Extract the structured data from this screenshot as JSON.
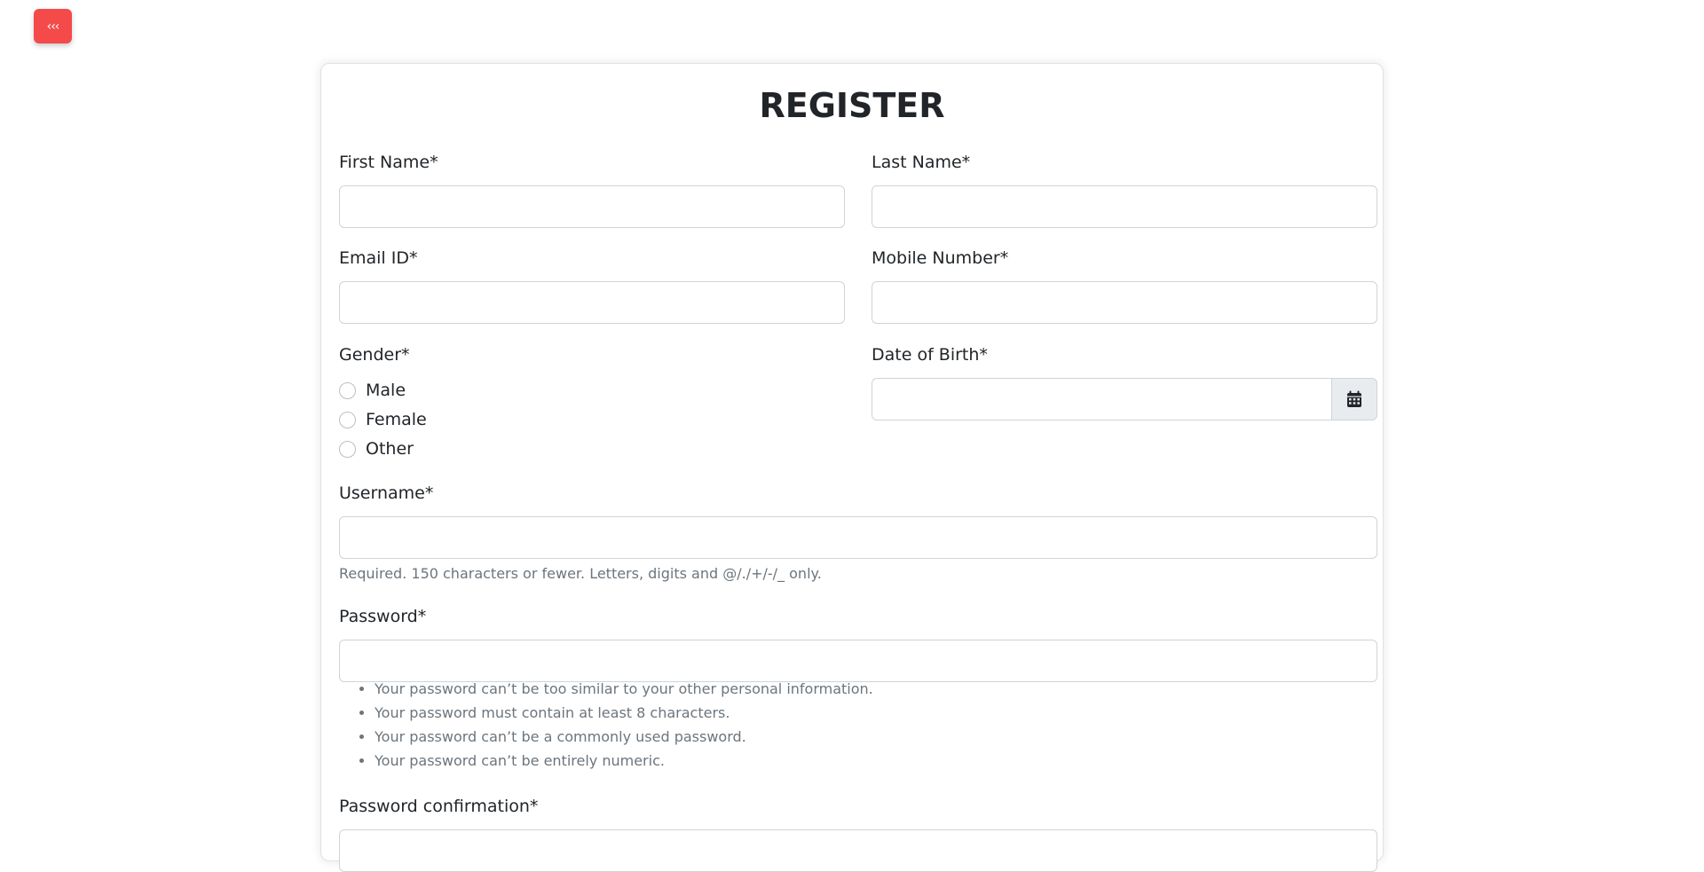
{
  "nav": {
    "back_label": "‹‹‹"
  },
  "form": {
    "title": "REGISTER",
    "first_name": {
      "label": "First Name*",
      "value": ""
    },
    "last_name": {
      "label": "Last Name*",
      "value": ""
    },
    "email": {
      "label": "Email ID*",
      "value": ""
    },
    "mobile": {
      "label": "Mobile Number*",
      "value": ""
    },
    "gender": {
      "label": "Gender*",
      "options": [
        "Male",
        "Female",
        "Other"
      ],
      "selected": null
    },
    "dob": {
      "label": "Date of Birth*",
      "value": "",
      "icon": "calendar-icon"
    },
    "username": {
      "label": "Username*",
      "value": "",
      "help": "Required. 150 characters or fewer. Letters, digits and @/./+/-/_ only."
    },
    "password": {
      "label": "Password*",
      "value": "",
      "rules": [
        "Your password can’t be too similar to your other personal information.",
        "Your password must contain at least 8 characters.",
        "Your password can’t be a commonly used password.",
        "Your password can’t be entirely numeric."
      ]
    },
    "password_confirmation": {
      "label": "Password confirmation*",
      "value": ""
    }
  },
  "colors": {
    "back_button": "#f44a4a",
    "input_border": "#ced4da",
    "help_text": "#6c757d",
    "addon_bg": "#e9ecef"
  }
}
